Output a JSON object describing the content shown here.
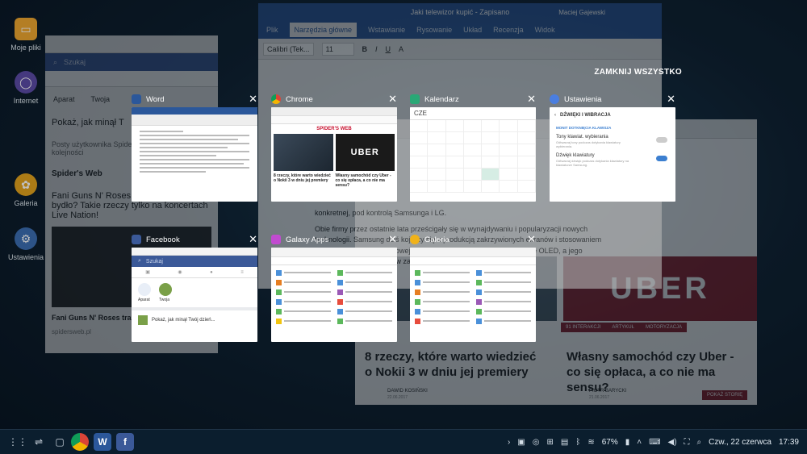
{
  "desktop": {
    "icons": [
      {
        "label": "Moje pliki",
        "icon": "folder-icon",
        "color": "#f0a830"
      },
      {
        "label": "Internet",
        "icon": "internet-icon",
        "color": "#5c4ca8"
      },
      {
        "label": "Galeria",
        "icon": "gallery-icon",
        "color": "#e6a41e"
      },
      {
        "label": "Ustawienia",
        "icon": "settings-icon",
        "color": "#3c6fb4"
      }
    ]
  },
  "background": {
    "word_title": "Jaki telewizor kupić - Zapisano",
    "word_user": "Maciej Gajewski",
    "word_tabs": [
      "Plik",
      "Narzędzia główne",
      "Wstawianie",
      "Rysowanie",
      "Układ",
      "Recenzja",
      "Widok"
    ],
    "word_font": "Calibri (Tek...",
    "word_size": "11",
    "word_paragraph": "Obie firmy przez ostatnie lata prześcigały się w wynajdywaniu i popularyzacji nowych technologii. Samsung dziś kojarzy się z produkcją zakrzywionych ekranów i stosowaniem na nich tak zwanej kwantowej kropki. LG z kolei inwestuje w technikę OLED, a jego podfirma LG Display jest w zasadzie...",
    "word_line2": "konkretnej, pod kontrolą Samsunga i LG.",
    "fb_search": "Szukaj",
    "fb_labels": [
      "Aparat",
      "Twoja"
    ],
    "fb_post": "Pokaż, jak minął T",
    "fb_posts_header": "Posty użytkownika Spider's W pierwszej kolejności",
    "fb_page": "Spider's Web",
    "fb_headline": "Fani Guns N' Roses traktowani jak bydło? Takie rzeczy tylko na koncertach Live Nation!",
    "fb_article": "Fani Guns N' Roses traktow trzeba nagłośnić",
    "fb_domain": "spidersweb.pl",
    "spider_headline1": "8 rzeczy, które warto wiedzieć o Nokii 3 w dniu jej premiery",
    "spider_headline2": "Własny samochód czy Uber - co się opłaca, a co nie ma sensu?",
    "spider_uber": "UBER",
    "spider_tags": [
      "91 INTERAKCJI",
      "ARTYKUŁ",
      "MOTORYZACJA"
    ],
    "spider_author1": "DAWID KOSIŃSKI",
    "spider_date1": "22.06.2017",
    "spider_author2": "PIOTR BARYCKI",
    "spider_date2": "21.06.2017",
    "spider_button": "POKAŻ STORIĘ"
  },
  "recents": {
    "close_all": "ZAMKNIJ WSZYSTKO",
    "cards": [
      {
        "title": "Word",
        "color": "#2b579a"
      },
      {
        "title": "Chrome",
        "color": "#e8e8e8"
      },
      {
        "title": "Kalendarz",
        "color": "#2aa876"
      },
      {
        "title": "Ustawienia",
        "color": "#4a7ee0"
      },
      {
        "title": "Facebook",
        "color": "#3b5998"
      },
      {
        "title": "Galaxy Apps",
        "color": "#c14bd0"
      },
      {
        "title": "Galeria",
        "color": "#f0b21a"
      }
    ],
    "chrome": {
      "logo": "SPIDER'S WEB",
      "uber": "UBER",
      "caption1": "8 rzeczy, które warto wiedzieć o Nokii 3 w dniu jej premiery",
      "caption2": "Własny samochód czy Uber - co się opłaca, a co nie ma sensu?"
    },
    "calendar": {
      "month": "CZE"
    },
    "settings": {
      "header": "DŹWIĘKI I WIBRACJA",
      "section": "MONIT DOTKNIĘCIA KLAWISZA",
      "row1": "Tony klawiat. wybierania",
      "row1_sub": "Odtwarzaj tony podczas dotykania klawiatury wybierania.",
      "row2": "Dźwięk klawiatury",
      "row2_sub": "Odtwarzaj dźwięk podczas dotykania klawiatury na klawiaturze Samsung.",
      "row1_on": false,
      "row2_on": true
    },
    "facebook": {
      "search": "Szukaj",
      "labels": [
        "Aparat",
        "Twoja"
      ],
      "post": "Pokaż, jak minął Twój dzień..."
    }
  },
  "taskbar": {
    "battery": "67%",
    "date": "Czw., 22 czerwca",
    "time": "17:39"
  }
}
